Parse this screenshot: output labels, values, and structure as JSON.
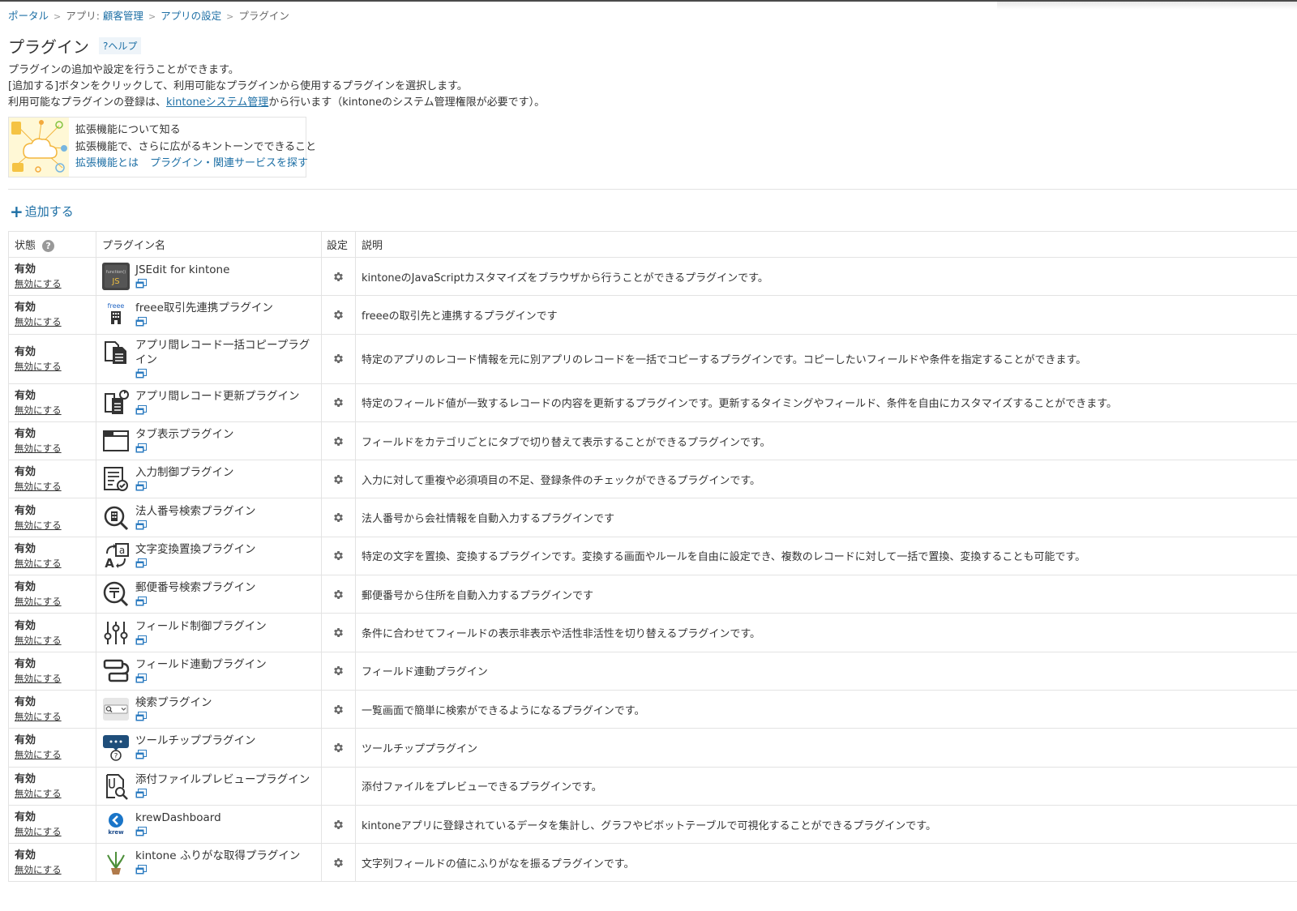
{
  "breadcrumb": {
    "portal": "ポータル",
    "app_prefix": "アプリ: ",
    "app_name": "顧客管理",
    "app_settings": "アプリの設定",
    "current": "プラグイン",
    "separator": ">"
  },
  "page": {
    "title": "プラグイン",
    "help": "?ヘルプ"
  },
  "description": {
    "line1": "プラグインの追加や設定を行うことができます。",
    "line2": "[追加する]ボタンをクリックして、利用可能なプラグインから使用するプラグインを選択します。",
    "line3_before": "利用可能なプラグインの登録は、",
    "line3_link": "kintoneシステム管理",
    "line3_after": "から行います（kintoneのシステム管理権限が必要です）。"
  },
  "extension_box": {
    "title": "拡張機能について知る",
    "subtitle": "拡張機能で、さらに広がるキントーンでできること",
    "link1": "拡張機能とは",
    "link2": "プラグイン・関連サービスを探す"
  },
  "add_button": {
    "plus": "+",
    "label": "追加する"
  },
  "table": {
    "headers": {
      "status": "状態",
      "status_help": "?",
      "name": "プラグイン名",
      "settings": "設定",
      "description": "説明"
    },
    "status_label": "有効",
    "disable_label": "無効にする",
    "rows": [
      {
        "name": "JSEdit for kintone",
        "desc": "kintoneのJavaScriptカスタマイズをブラウザから行うことができるプラグインです。",
        "icon": "jsedit-icon",
        "gear": true
      },
      {
        "name": "freee取引先連携プラグイン",
        "desc": "freeeの取引先と連携するプラグインです",
        "icon": "freee-icon",
        "icon_text": "freee",
        "gear": true
      },
      {
        "name": "アプリ間レコード一括コピープラグイン",
        "desc": "特定のアプリのレコード情報を元に別アプリのレコードを一括でコピーするプラグインです。コピーしたいフィールドや条件を指定することができます。",
        "icon": "copy-records-icon",
        "gear": true,
        "tall": true
      },
      {
        "name": "アプリ間レコード更新プラグイン",
        "desc": "特定のフィールド値が一致するレコードの内容を更新するプラグインです。更新するタイミングやフィールド、条件を自由にカスタマイズすることができます。",
        "icon": "update-records-icon",
        "gear": true
      },
      {
        "name": "タブ表示プラグイン",
        "desc": "フィールドをカテゴリごとにタブで切り替えて表示することができるプラグインです。",
        "icon": "tab-icon",
        "gear": true
      },
      {
        "name": "入力制御プラグイン",
        "desc": "入力に対して重複や必須項目の不足、登録条件のチェックができるプラグインです。",
        "icon": "input-check-icon",
        "gear": true
      },
      {
        "name": "法人番号検索プラグイン",
        "desc": "法人番号から会社情報を自動入力するプラグインです",
        "icon": "corporate-search-icon",
        "gear": true
      },
      {
        "name": "文字変換置換プラグイン",
        "desc": "特定の文字を置換、変換するプラグインです。変換する画面やルールを自由に設定でき、複数のレコードに対して一括で置換、変換することも可能です。",
        "icon": "text-convert-icon",
        "icon_text_a": "a",
        "icon_text_b": "A",
        "gear": true
      },
      {
        "name": "郵便番号検索プラグイン",
        "desc": "郵便番号から住所を自動入力するプラグインです",
        "icon": "postal-search-icon",
        "gear": true
      },
      {
        "name": "フィールド制御プラグイン",
        "desc": "条件に合わせてフィールドの表示非表示や活性非活性を切り替えるプラグインです。",
        "icon": "sliders-icon",
        "gear": true
      },
      {
        "name": "フィールド連動プラグイン",
        "desc": "フィールド連動プラグイン",
        "icon": "field-link-icon",
        "gear": true
      },
      {
        "name": "検索プラグイン",
        "desc": "一覧画面で簡単に検索ができるようになるプラグインです。",
        "icon": "search-box-icon",
        "gear": true
      },
      {
        "name": "ツールチッププラグイン",
        "desc": "ツールチッププラグイン",
        "icon": "tooltip-icon",
        "icon_text": "?",
        "gear": true
      },
      {
        "name": "添付ファイルプレビュープラグイン",
        "desc": "添付ファイルをプレビューできるプラグインです。",
        "icon": "file-preview-icon",
        "gear": false
      },
      {
        "name": "krewDashboard",
        "desc": "kintoneアプリに登録されているデータを集計し、グラフやピボットテーブルで可視化することができるプラグインです。",
        "icon": "krew-icon",
        "icon_text": "krew",
        "gear": true
      },
      {
        "name": "kintone ふりがな取得プラグイン",
        "desc": "文字列フィールドの値にふりがなを振るプラグインです。",
        "icon": "plant-icon",
        "gear": true
      }
    ]
  },
  "colors": {
    "link": "#1d6fa5",
    "border": "#e3e3e3",
    "text": "#333333"
  }
}
